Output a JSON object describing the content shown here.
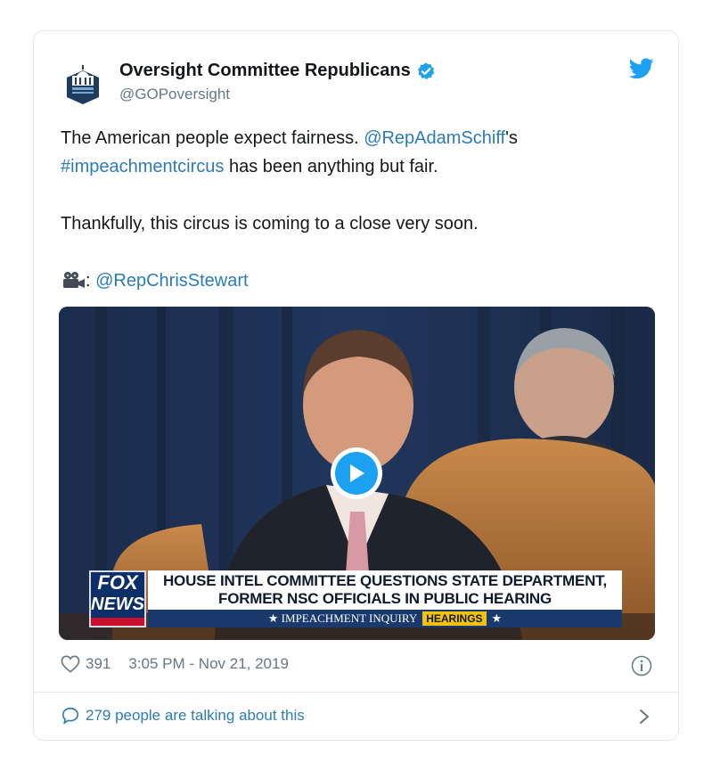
{
  "tweet": {
    "account_name": "Oversight Committee Republicans",
    "handle": "@GOPoversight",
    "line1_text": "The American people expect fairness. ",
    "line1_mention": "@RepAdamSchiff",
    "line1_suffix": "'s",
    "line2_hashtag": "#impeachmentcircus",
    "line2_text": " has been anything but fair.",
    "line3_text": "Thankfully, this circus is coming to a close very soon.",
    "credit_separator": ": ",
    "credit_mention": "@RepChrisStewart"
  },
  "video": {
    "network_logo_line1": "FOX",
    "network_logo_line2": "NEWS",
    "headline_line1": "HOUSE INTEL COMMITTEE QUESTIONS STATE DEPARTMENT,",
    "headline_line2": "FORMER NSC OFFICIALS IN PUBLIC HEARING",
    "subbar_label": "★ IMPEACHMENT INQUIRY",
    "subbar_badge": "HEARINGS",
    "subbar_end": "★"
  },
  "footer": {
    "likes": "391",
    "timestamp": "3:05 PM - Nov 21, 2019",
    "conversation": "279 people are talking about this"
  },
  "colors": {
    "link": "#2b7bb9",
    "twitter_blue": "#1da1f2",
    "muted": "#657786",
    "border": "#e1e8ed"
  },
  "icons": [
    "capitol-logo",
    "verified-badge-icon",
    "twitter-bird-icon",
    "movie-camera-icon",
    "play-icon",
    "heart-icon",
    "info-icon",
    "speech-bubble-icon",
    "chevron-right-icon"
  ]
}
